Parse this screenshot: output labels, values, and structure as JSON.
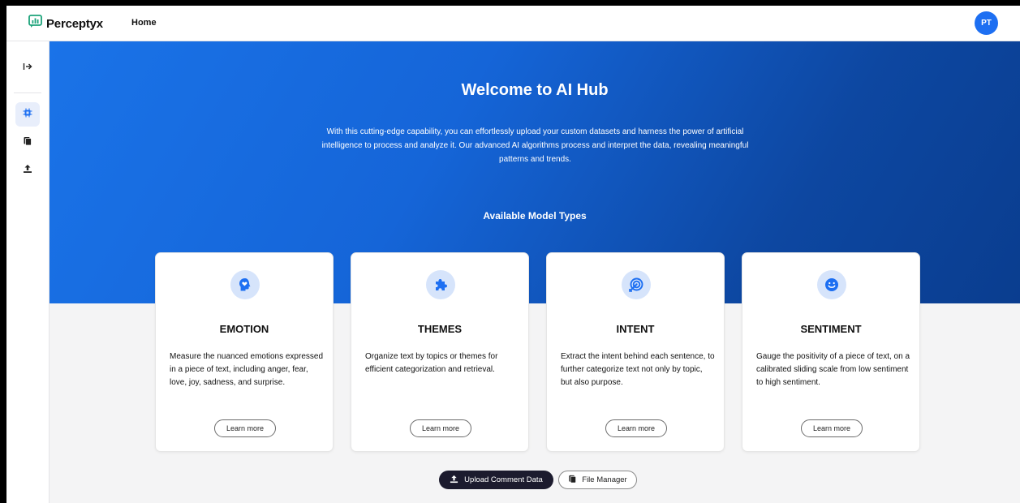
{
  "app": {
    "brand": "Perceptyx",
    "nav_home": "Home",
    "avatar_initials": "PT"
  },
  "sidebar": {
    "items": [
      {
        "icon": "expand-arrow-icon"
      },
      {
        "icon": "chip-icon",
        "active": true
      },
      {
        "icon": "files-icon"
      },
      {
        "icon": "upload-icon"
      }
    ]
  },
  "hero": {
    "title": "Welcome to AI Hub",
    "description": "With this cutting-edge capability, you can effortlessly upload your custom datasets and harness the power of artificial intelligence to process and analyze it. Our advanced AI algorithms process and interpret the data, revealing meaningful patterns and trends.",
    "subtitle": "Available Model Types"
  },
  "cards": [
    {
      "icon": "head-heart-icon",
      "title": "EMOTION",
      "description": "Measure the nuanced emotions expressed in a piece of text, including anger, fear, love, joy, sadness, and surprise.",
      "button": "Learn more"
    },
    {
      "icon": "puzzle-icon",
      "title": "THEMES",
      "description": "Organize text by topics or themes for efficient categorization and retrieval.",
      "button": "Learn more"
    },
    {
      "icon": "target-icon",
      "title": "INTENT",
      "description": "Extract the intent behind each sentence, to further categorize text not only by topic, but also purpose.",
      "button": "Learn more"
    },
    {
      "icon": "smiley-icon",
      "title": "SENTIMENT",
      "description": "Gauge the positivity of a piece of text, on a calibrated sliding scale from low sentiment to high sentiment.",
      "button": "Learn more"
    }
  ],
  "actions": {
    "upload_label": "Upload Comment Data",
    "files_label": "File Manager"
  },
  "colors": {
    "accent": "#1d6ff2",
    "hero_start": "#1a73e8",
    "hero_end": "#0a3d8f",
    "dark_button": "#1c1b2e"
  }
}
